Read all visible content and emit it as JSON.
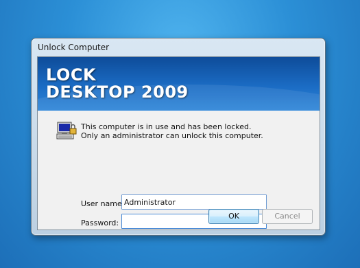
{
  "window": {
    "title": "Unlock Computer"
  },
  "banner": {
    "line1": "LOCK",
    "line2": "DESKTOP 2009"
  },
  "message": {
    "line1": "This computer is in use and has been locked.",
    "line2": "Only an administrator can unlock this computer."
  },
  "form": {
    "username_label": "User name:",
    "username_value": "Administrator",
    "password_label": "Password:",
    "password_value": ""
  },
  "buttons": {
    "ok": "OK",
    "cancel": "Cancel"
  },
  "icons": {
    "lock": "computer-lock-icon"
  },
  "colors": {
    "banner": "#1b6cc4",
    "desktop": "#2b8fd6"
  }
}
